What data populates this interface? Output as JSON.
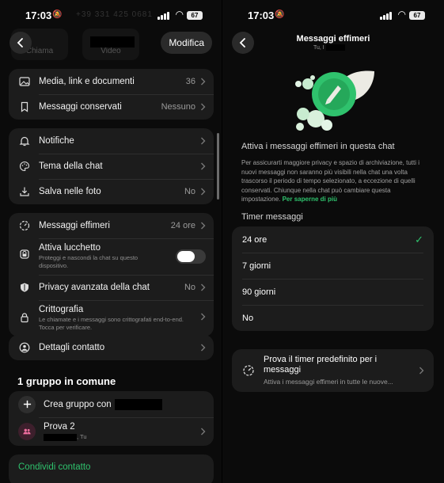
{
  "status": {
    "time": "17:03",
    "battery": "67",
    "faded_number": "+39 331 425 0681"
  },
  "left": {
    "edit_label": "Modifica",
    "actions": {
      "call": "Chiama",
      "video": "Video"
    },
    "media": {
      "label": "Media, link e documenti",
      "value": "36"
    },
    "saved": {
      "label": "Messaggi conservati",
      "value": "Nessuno"
    },
    "notifications": {
      "label": "Notifiche"
    },
    "theme": {
      "label": "Tema della chat"
    },
    "save_photos": {
      "label": "Salva nelle foto",
      "value": "No"
    },
    "ephemeral": {
      "label": "Messaggi effimeri",
      "value": "24 ore"
    },
    "lock": {
      "label": "Attiva lucchetto",
      "sub": "Proteggi e nascondi la chat su questo dispositivo."
    },
    "privacy": {
      "label": "Privacy avanzata della chat",
      "value": "No"
    },
    "encryption": {
      "label": "Crittografia",
      "sub": "Le chiamate e i messaggi sono crittografati end-to-end. Tocca per verificare."
    },
    "contact_details": {
      "label": "Dettagli contatto"
    },
    "groups_title": "1 gruppo in comune",
    "create_group": {
      "label": "Crea gruppo con"
    },
    "group": {
      "name": "Prova 2",
      "members_suffix": ", Tu"
    },
    "share_contact": "Condividi contatto"
  },
  "right": {
    "title": "Messaggi effimeri",
    "subtitle": "Tu, I",
    "heading": "Attiva i messaggi effimeri in questa chat",
    "description": "Per assicurarti maggiore privacy e spazio di archiviazione, tutti i nuovi messaggi non saranno più visibili nella chat una volta trascorso il periodo di tempo selezionato, a eccezione di quelli conservati. Chiunque nella chat può cambiare questa impostazione.",
    "learn_more": "Per saperne di più",
    "timer_title": "Timer messaggi",
    "options": [
      "24 ore",
      "7 giorni",
      "90 giorni",
      "No"
    ],
    "selected_index": 0,
    "promo": {
      "title": "Prova il timer predefinito per i messaggi",
      "subtitle": "Attiva i messaggi effimeri in tutte le nuove..."
    }
  },
  "colors": {
    "accent": "#2fc26d",
    "card": "#1c1c1c",
    "background": "#0b0b0b"
  }
}
